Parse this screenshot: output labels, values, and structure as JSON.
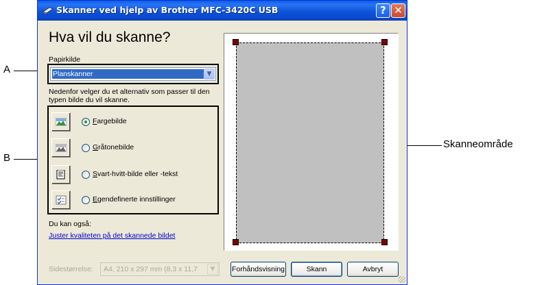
{
  "window": {
    "title": "Skanner ved hjelp av Brother MFC-3420C USB",
    "help_label": "?",
    "close_label": "✕"
  },
  "main": {
    "heading": "Hva vil du skanne?",
    "paper_source_label": "Papirkilde",
    "paper_source_value": "Planskanner",
    "description": "Nedenfor velger du et alternativ som passer til den typen bilde du vil skanne.",
    "options": [
      {
        "label_prefix": "",
        "label_access": "F",
        "label_rest": "argebilde",
        "selected": true,
        "icon": "color-photo-icon"
      },
      {
        "label_prefix": "",
        "label_access": "G",
        "label_rest": "råtonebilde",
        "selected": false,
        "icon": "grayscale-photo-icon"
      },
      {
        "label_prefix": "",
        "label_access": "S",
        "label_rest": "vart-hvitt-bilde eller -tekst",
        "selected": false,
        "icon": "black-white-text-icon"
      },
      {
        "label_prefix": "",
        "label_access": "E",
        "label_rest": "gendefinerte innstillinger",
        "selected": false,
        "icon": "custom-settings-icon"
      }
    ],
    "also_label": "Du kan også:",
    "quality_link": "Juster kvaliteten på det skannede bildet"
  },
  "footer": {
    "page_size_label": "Sidestørrelse:",
    "page_size_value": "A4, 210 x 297 mm (8,3 x 11,7",
    "preview_button": "Forhåndsvisning",
    "scan_button": "Skann",
    "cancel_button": "Avbryt"
  },
  "callouts": {
    "a": "A",
    "b": "B",
    "scan_area": "Skanneområde"
  },
  "colors": {
    "titlebar": "#0a5fe8",
    "selection": "#316ac5",
    "scan_area": "#c0c0c0",
    "handle": "#800000",
    "link": "#0000cc"
  }
}
